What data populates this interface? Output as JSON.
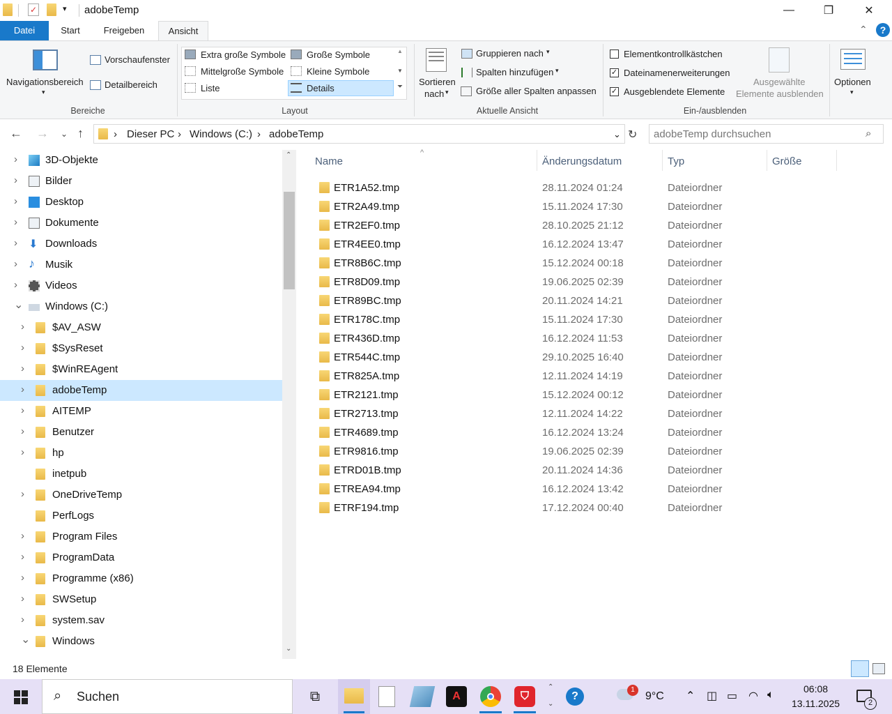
{
  "window": {
    "title": "adobeTemp",
    "controls": {
      "minimize": "—",
      "maximize": "❐",
      "close": "✕"
    }
  },
  "ribbon_tabs": [
    "Datei",
    "Start",
    "Freigeben",
    "Ansicht"
  ],
  "ribbon": {
    "bereiche": {
      "navigationsbereich": "Navigationsbereich",
      "vorschaufenster": "Vorschaufenster",
      "detailbereich": "Detailbereich",
      "label": "Bereiche"
    },
    "layout": {
      "options": [
        "Extra große Symbole",
        "Große Symbole",
        "Mittelgroße Symbole",
        "Kleine Symbole",
        "Liste",
        "Details"
      ],
      "selected": "Details",
      "label": "Layout"
    },
    "aktuelle_ansicht": {
      "sortieren": "Sortieren",
      "nach": "nach",
      "gruppieren": "Gruppieren nach",
      "spalten": "Spalten hinzufügen",
      "groesse": "Größe aller Spalten anpassen",
      "label": "Aktuelle Ansicht"
    },
    "ein_ausblenden": {
      "elementkontroll": "Elementkontrollkästchen",
      "elementkontroll_checked": false,
      "dateinamen": "Dateinamenerweiterungen",
      "dateinamen_checked": true,
      "ausgeblendete": "Ausgeblendete Elemente",
      "ausgeblendete_checked": true,
      "ausgewaehlte_1": "Ausgewählte",
      "ausgewaehlte_2": "Elemente ausblenden",
      "label": "Ein-/ausblenden"
    },
    "optionen": "Optionen"
  },
  "address": {
    "crumbs": [
      "Dieser PC",
      "Windows (C:)",
      "adobeTemp"
    ],
    "search_placeholder": "adobeTemp durchsuchen"
  },
  "nav": [
    {
      "label": "3D-Objekte",
      "icon": "3d-objects-icon",
      "level": 0,
      "expand": "›"
    },
    {
      "label": "Bilder",
      "icon": "pictures-icon",
      "level": 0,
      "expand": "›"
    },
    {
      "label": "Desktop",
      "icon": "desktop-icon",
      "level": 0,
      "expand": "›"
    },
    {
      "label": "Dokumente",
      "icon": "documents-icon",
      "level": 0,
      "expand": "›"
    },
    {
      "label": "Downloads",
      "icon": "downloads-icon",
      "level": 0,
      "expand": "›"
    },
    {
      "label": "Musik",
      "icon": "music-icon",
      "level": 0,
      "expand": "›"
    },
    {
      "label": "Videos",
      "icon": "videos-icon",
      "level": 0,
      "expand": "›"
    },
    {
      "label": "Windows (C:)",
      "icon": "drive-icon",
      "level": 0,
      "expand": "⌄"
    },
    {
      "label": "$AV_ASW",
      "icon": "folder-icon",
      "level": 1,
      "expand": "›"
    },
    {
      "label": "$SysReset",
      "icon": "folder-icon",
      "level": 1,
      "expand": "›"
    },
    {
      "label": "$WinREAgent",
      "icon": "folder-icon",
      "level": 1,
      "expand": "›"
    },
    {
      "label": "adobeTemp",
      "icon": "folder-icon",
      "level": 1,
      "expand": "›",
      "selected": true
    },
    {
      "label": "AITEMP",
      "icon": "folder-icon",
      "level": 1,
      "expand": "›"
    },
    {
      "label": "Benutzer",
      "icon": "folder-icon",
      "level": 1,
      "expand": "›"
    },
    {
      "label": "hp",
      "icon": "folder-icon",
      "level": 1,
      "expand": "›"
    },
    {
      "label": "inetpub",
      "icon": "folder-icon",
      "level": 1,
      "expand": ""
    },
    {
      "label": "OneDriveTemp",
      "icon": "folder-icon",
      "level": 1,
      "expand": "›"
    },
    {
      "label": "PerfLogs",
      "icon": "folder-icon",
      "level": 1,
      "expand": ""
    },
    {
      "label": "Program Files",
      "icon": "folder-icon",
      "level": 1,
      "expand": "›"
    },
    {
      "label": "ProgramData",
      "icon": "folder-icon",
      "level": 1,
      "expand": "›"
    },
    {
      "label": "Programme (x86)",
      "icon": "folder-icon",
      "level": 1,
      "expand": "›"
    },
    {
      "label": "SWSetup",
      "icon": "folder-icon",
      "level": 1,
      "expand": "›"
    },
    {
      "label": "system.sav",
      "icon": "folder-icon",
      "level": 1,
      "expand": "›"
    },
    {
      "label": "Windows",
      "icon": "folder-icon",
      "level": 1,
      "expand": "⌄"
    }
  ],
  "columns": {
    "name": "Name",
    "date": "Änderungsdatum",
    "type": "Typ",
    "size": "Größe"
  },
  "files": [
    {
      "name": "ETR1A52.tmp",
      "date": "28.11.2024 01:24",
      "type": "Dateiordner"
    },
    {
      "name": "ETR2A49.tmp",
      "date": "15.11.2024 17:30",
      "type": "Dateiordner"
    },
    {
      "name": "ETR2EF0.tmp",
      "date": "28.10.2025 21:12",
      "type": "Dateiordner"
    },
    {
      "name": "ETR4EE0.tmp",
      "date": "16.12.2024 13:47",
      "type": "Dateiordner"
    },
    {
      "name": "ETR8B6C.tmp",
      "date": "15.12.2024 00:18",
      "type": "Dateiordner"
    },
    {
      "name": "ETR8D09.tmp",
      "date": "19.06.2025 02:39",
      "type": "Dateiordner"
    },
    {
      "name": "ETR89BC.tmp",
      "date": "20.11.2024 14:21",
      "type": "Dateiordner"
    },
    {
      "name": "ETR178C.tmp",
      "date": "15.11.2024 17:30",
      "type": "Dateiordner"
    },
    {
      "name": "ETR436D.tmp",
      "date": "16.12.2024 11:53",
      "type": "Dateiordner"
    },
    {
      "name": "ETR544C.tmp",
      "date": "29.10.2025 16:40",
      "type": "Dateiordner"
    },
    {
      "name": "ETR825A.tmp",
      "date": "12.11.2024 14:19",
      "type": "Dateiordner"
    },
    {
      "name": "ETR2121.tmp",
      "date": "15.12.2024 00:12",
      "type": "Dateiordner"
    },
    {
      "name": "ETR2713.tmp",
      "date": "12.11.2024 14:22",
      "type": "Dateiordner"
    },
    {
      "name": "ETR4689.tmp",
      "date": "16.12.2024 13:24",
      "type": "Dateiordner"
    },
    {
      "name": "ETR9816.tmp",
      "date": "19.06.2025 02:39",
      "type": "Dateiordner"
    },
    {
      "name": "ETRD01B.tmp",
      "date": "20.11.2024 14:36",
      "type": "Dateiordner"
    },
    {
      "name": "ETREA94.tmp",
      "date": "16.12.2024 13:42",
      "type": "Dateiordner"
    },
    {
      "name": "ETRF194.tmp",
      "date": "17.12.2024 00:40",
      "type": "Dateiordner"
    }
  ],
  "status": {
    "count": "18 Elemente"
  },
  "taskbar": {
    "search": "Suchen",
    "weather_temp": "9°C",
    "weather_badge": "1",
    "time": "06:08",
    "date": "13.11.2025",
    "notifications": "2"
  },
  "colors": {
    "accent": "#1979ca",
    "selection": "#cce8ff",
    "taskbar": "#e6e0f6",
    "folder": "#e9b949"
  }
}
